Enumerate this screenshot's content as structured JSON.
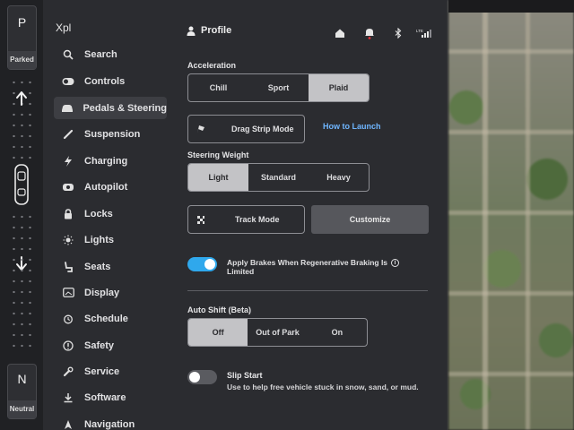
{
  "gear": {
    "top_letter": "P",
    "top_label": "Parked",
    "bottom_letter": "N",
    "bottom_label": "Neutral"
  },
  "sidebar": {
    "user_name": "Xpl",
    "items": [
      {
        "label": "Search",
        "icon": "search-icon"
      },
      {
        "label": "Controls",
        "icon": "toggle-icon"
      },
      {
        "label": "Pedals & Steering",
        "icon": "car-icon",
        "active": true
      },
      {
        "label": "Suspension",
        "icon": "wrench-pen-icon"
      },
      {
        "label": "Charging",
        "icon": "bolt-icon"
      },
      {
        "label": "Autopilot",
        "icon": "steering-icon"
      },
      {
        "label": "Locks",
        "icon": "lock-icon"
      },
      {
        "label": "Lights",
        "icon": "sun-icon"
      },
      {
        "label": "Seats",
        "icon": "seat-icon"
      },
      {
        "label": "Display",
        "icon": "display-icon"
      },
      {
        "label": "Schedule",
        "icon": "alarm-clock-icon"
      },
      {
        "label": "Safety",
        "icon": "alert-circle-icon"
      },
      {
        "label": "Service",
        "icon": "wrench-icon"
      },
      {
        "label": "Software",
        "icon": "download-icon"
      },
      {
        "label": "Navigation",
        "icon": "navigation-arrow-icon"
      }
    ]
  },
  "header": {
    "profile_label": "Profile",
    "status_icons": [
      "home-icon",
      "bell-icon",
      "bluetooth-icon",
      "lte-signal-icon"
    ],
    "signal_text": "LTE"
  },
  "acceleration": {
    "title": "Acceleration",
    "options": [
      "Chill",
      "Sport",
      "Plaid"
    ],
    "selected": "Plaid"
  },
  "drag_strip": {
    "label": "Drag Strip Mode",
    "link": "How to Launch"
  },
  "steering_weight": {
    "title": "Steering Weight",
    "options": [
      "Light",
      "Standard",
      "Heavy"
    ],
    "selected": "Light"
  },
  "track_mode": {
    "label": "Track Mode",
    "customize": "Customize"
  },
  "regen": {
    "label_line1": "Apply Brakes When Regenerative Braking Is",
    "label_line2": "Limited",
    "enabled": true
  },
  "auto_shift": {
    "title": "Auto Shift (Beta)",
    "options": [
      "Off",
      "Out of Park",
      "On"
    ],
    "selected": "Off"
  },
  "slip_start": {
    "title": "Slip Start",
    "description": "Use to help free vehicle stuck in snow, sand, or mud.",
    "enabled": false
  },
  "colors": {
    "accent_toggle": "#2fa8ec",
    "link": "#6fb6ff",
    "panel_bg": "#2b2c30",
    "selected_segment": "#c3c3c6",
    "alert_dot": "#e8333a"
  }
}
